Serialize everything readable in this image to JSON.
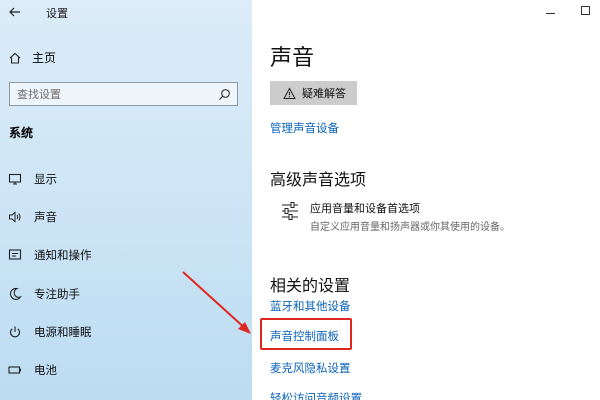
{
  "window": {
    "title": "设置"
  },
  "sidebar": {
    "home_label": "主页",
    "search_placeholder": "查找设置",
    "section_label": "系统",
    "items": [
      {
        "label": "显示",
        "icon": "monitor-icon"
      },
      {
        "label": "声音",
        "icon": "speaker-icon"
      },
      {
        "label": "通知和操作",
        "icon": "notification-icon"
      },
      {
        "label": "专注助手",
        "icon": "moon-icon"
      },
      {
        "label": "电源和睡眠",
        "icon": "power-icon"
      },
      {
        "label": "电池",
        "icon": "battery-icon"
      }
    ]
  },
  "main": {
    "title": "声音",
    "troubleshoot_label": "疑难解答",
    "manage_devices_link": "管理声音设备",
    "advanced_heading": "高级声音选项",
    "advanced_item": {
      "title": "应用音量和设备首选项",
      "description": "自定义应用音量和扬声器或你其使用的设备。"
    },
    "related_heading": "相关的设置",
    "related_links": [
      "蓝牙和其他设备",
      "声音控制面板",
      "麦克风隐私设置",
      "轻松访问音频设置"
    ]
  },
  "annotation": {
    "color": "#e0271f",
    "highlighted_link": "声音控制面板"
  },
  "colors": {
    "link": "#0b63b8",
    "button_bg": "#cccccc",
    "sidebar_bg": "#cfe6f6"
  }
}
